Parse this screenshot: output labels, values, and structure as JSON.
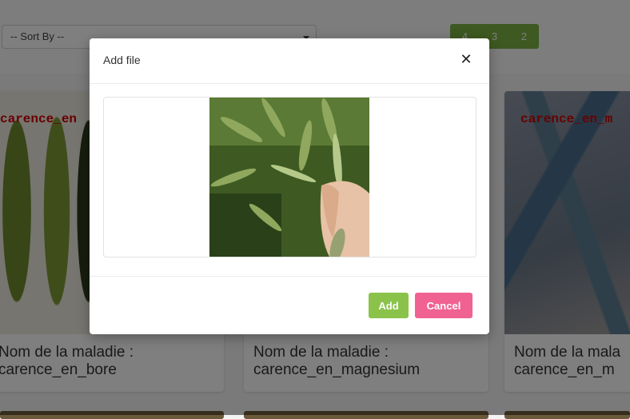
{
  "toolbar": {
    "sort_placeholder": "-- Sort By --",
    "pagination": [
      "4",
      "3",
      "2"
    ]
  },
  "cards": [
    {
      "overlay": "carence_en",
      "caption_line1": "Nom de la maladie :",
      "caption_line2": "carence_en_bore"
    },
    {
      "overlay": "",
      "caption_line1": "Nom de la maladie :",
      "caption_line2": "carence_en_magnesium"
    },
    {
      "overlay": "carence_en_m",
      "caption_line1": "Nom de la mala",
      "caption_line2": "carence_en_m"
    }
  ],
  "modal": {
    "title": "Add file",
    "close_icon": "close-icon",
    "add_label": "Add",
    "cancel_label": "Cancel"
  },
  "colors": {
    "accent_green": "#8bc34a",
    "cancel_pink": "#f06292",
    "pager_green": "#7cb342"
  }
}
